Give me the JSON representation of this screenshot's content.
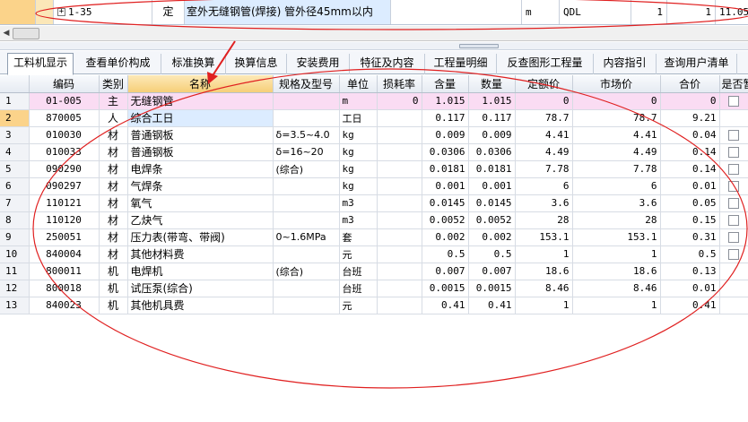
{
  "top_row": {
    "expand_symbol": "+",
    "code": "1-35",
    "type": "定",
    "name": "室外无缝钢管(焊接) 管外径45mm以内",
    "unit": "m",
    "qty_expr": "QDL",
    "qty": "1",
    "qty2": "1",
    "price": "11.05"
  },
  "scrollbar": {
    "left_arrow": "◀"
  },
  "tabs": [
    {
      "label": "工料机显示",
      "active": true
    },
    {
      "label": "查看单价构成",
      "active": false
    },
    {
      "label": "标准换算",
      "active": false
    },
    {
      "label": "换算信息",
      "active": false
    },
    {
      "label": "安装费用",
      "active": false
    },
    {
      "label": "特征及内容",
      "active": false
    },
    {
      "label": "工程量明细",
      "active": false
    },
    {
      "label": "反查图形工程量",
      "active": false
    },
    {
      "label": "内容指引",
      "active": false
    },
    {
      "label": "查询用户清单",
      "active": false
    }
  ],
  "grid": {
    "columns": [
      "编码",
      "类别",
      "名称",
      "规格及型号",
      "单位",
      "损耗率",
      "含量",
      "数量",
      "定额价",
      "市场价",
      "合价",
      "是否暂估"
    ],
    "rows": [
      {
        "n": "1",
        "code": "01-005",
        "cat": "主",
        "name": "无缝钢管",
        "spec": "",
        "unit": "m",
        "loss": "0",
        "content": "1.015",
        "qty": "1.015",
        "quota": "0",
        "market": "0",
        "total": "0",
        "check": true
      },
      {
        "n": "2",
        "code": "870005",
        "cat": "人",
        "name": "综合工日",
        "spec": "",
        "unit": "工日",
        "loss": "",
        "content": "0.117",
        "qty": "0.117",
        "quota": "78.7",
        "market": "78.7",
        "total": "9.21",
        "check": false
      },
      {
        "n": "3",
        "code": "010030",
        "cat": "材",
        "name": "普通钢板",
        "spec": "δ=3.5~4.0",
        "unit": "kg",
        "loss": "",
        "content": "0.009",
        "qty": "0.009",
        "quota": "4.41",
        "market": "4.41",
        "total": "0.04",
        "check": true
      },
      {
        "n": "4",
        "code": "010033",
        "cat": "材",
        "name": "普通钢板",
        "spec": "δ=16~20",
        "unit": "kg",
        "loss": "",
        "content": "0.0306",
        "qty": "0.0306",
        "quota": "4.49",
        "market": "4.49",
        "total": "0.14",
        "check": true
      },
      {
        "n": "5",
        "code": "090290",
        "cat": "材",
        "name": "电焊条",
        "spec": "(综合)",
        "unit": "kg",
        "loss": "",
        "content": "0.0181",
        "qty": "0.0181",
        "quota": "7.78",
        "market": "7.78",
        "total": "0.14",
        "check": true
      },
      {
        "n": "6",
        "code": "090297",
        "cat": "材",
        "name": "气焊条",
        "spec": "",
        "unit": "kg",
        "loss": "",
        "content": "0.001",
        "qty": "0.001",
        "quota": "6",
        "market": "6",
        "total": "0.01",
        "check": true
      },
      {
        "n": "7",
        "code": "110121",
        "cat": "材",
        "name": "氧气",
        "spec": "",
        "unit": "m3",
        "loss": "",
        "content": "0.0145",
        "qty": "0.0145",
        "quota": "3.6",
        "market": "3.6",
        "total": "0.05",
        "check": true
      },
      {
        "n": "8",
        "code": "110120",
        "cat": "材",
        "name": "乙炔气",
        "spec": "",
        "unit": "m3",
        "loss": "",
        "content": "0.0052",
        "qty": "0.0052",
        "quota": "28",
        "market": "28",
        "total": "0.15",
        "check": true
      },
      {
        "n": "9",
        "code": "250051",
        "cat": "材",
        "name": "压力表(带弯、带阀)",
        "spec": "0~1.6MPa",
        "unit": "套",
        "loss": "",
        "content": "0.002",
        "qty": "0.002",
        "quota": "153.1",
        "market": "153.1",
        "total": "0.31",
        "check": true
      },
      {
        "n": "10",
        "code": "840004",
        "cat": "材",
        "name": "其他材料费",
        "spec": "",
        "unit": "元",
        "loss": "",
        "content": "0.5",
        "qty": "0.5",
        "quota": "1",
        "market": "1",
        "total": "0.5",
        "check": true
      },
      {
        "n": "11",
        "code": "800011",
        "cat": "机",
        "name": "电焊机",
        "spec": "(综合)",
        "unit": "台班",
        "loss": "",
        "content": "0.007",
        "qty": "0.007",
        "quota": "18.6",
        "market": "18.6",
        "total": "0.13",
        "check": false
      },
      {
        "n": "12",
        "code": "800018",
        "cat": "机",
        "name": "试压泵(综合)",
        "spec": "",
        "unit": "台班",
        "loss": "",
        "content": "0.0015",
        "qty": "0.0015",
        "quota": "8.46",
        "market": "8.46",
        "total": "0.01",
        "check": false
      },
      {
        "n": "13",
        "code": "840023",
        "cat": "机",
        "name": "其他机具费",
        "spec": "",
        "unit": "元",
        "loss": "",
        "content": "0.41",
        "qty": "0.41",
        "quota": "1",
        "market": "1",
        "total": "0.41",
        "check": false
      }
    ]
  },
  "colors": {
    "annotation": "#e02020",
    "main_row": "#fadcf3",
    "selected_cell": "#dcecff",
    "sorted_header": "#f6cf78"
  }
}
